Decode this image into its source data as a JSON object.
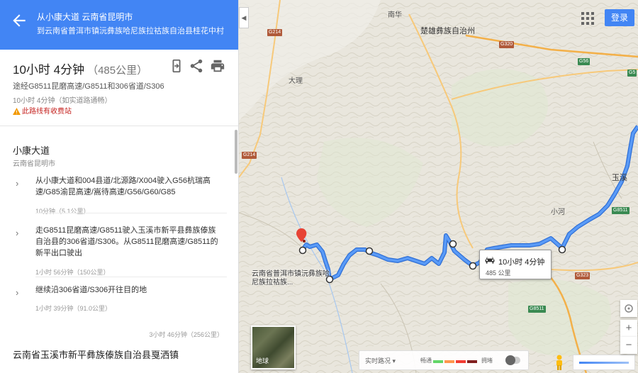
{
  "header": {
    "origin": "从小康大道 云南省昆明市",
    "destination": "到云南省普洱市镇沅彝族哈尼族拉祜族自治县桂花中村"
  },
  "summary": {
    "duration": "10小时 4分钟",
    "distance": "（485公里）",
    "via": "途经G8511昆磨高速/G8511和306省道/S306",
    "traffic": "10小时 4分钟（如实道路通畅）",
    "warning": "此路线有收费站"
  },
  "steps": {
    "origin_name": "小康大道",
    "origin_sub": "云南省昆明市",
    "items": [
      {
        "text": "从小康大道和004县道/北源路/X004驶入G56杭瑞高速/G85渝昆高速/嵩待高速/G56/G60/G85",
        "meta": "10分钟（5.1公里）"
      },
      {
        "text": "走G8511昆磨高速/G8511驶入玉溪市新平县彝族傣族自治县的306省道/S306。从G8511昆磨高速/G8511的新平出口驶出",
        "meta": "1小时 56分钟（150公里）"
      },
      {
        "text": "继续沿306省道/S306开往目的地",
        "meta": "1小时 39分钟（91.0公里）"
      }
    ],
    "total": "3小时 46分钟（256公里）",
    "dest_name": "云南省玉溪市新平彝族傣族自治县戛洒镇"
  },
  "map": {
    "signin": "登录",
    "callout_time": "10小时 4分钟",
    "callout_dist": "485 公里",
    "start_label": "云南省普洱市镇沅彝族哈尼族拉祜族...",
    "satellite_label": "地球",
    "traffic_select": "实时路况 ▾",
    "traffic_fast": "畅通",
    "traffic_slow": "拥堵",
    "towns": [
      "楚雄彝族自治州",
      "玉溪",
      "大理",
      "南华",
      "小河"
    ],
    "roads": [
      "G214",
      "G320",
      "G214",
      "G56",
      "G5",
      "G8511",
      "G323",
      "G8511"
    ]
  },
  "colors": {
    "brand": "#4285f4",
    "route": "#4a8ff0",
    "warning": "#c5221f",
    "traffic": [
      "#63d668",
      "#ff974d",
      "#f23c32",
      "#811f1f"
    ]
  },
  "icons": [
    "back-arrow-icon",
    "send-to-phone-icon",
    "share-icon",
    "print-icon",
    "warning-icon",
    "apps-grid-icon",
    "car-icon",
    "pegman-icon",
    "compass-icon"
  ]
}
